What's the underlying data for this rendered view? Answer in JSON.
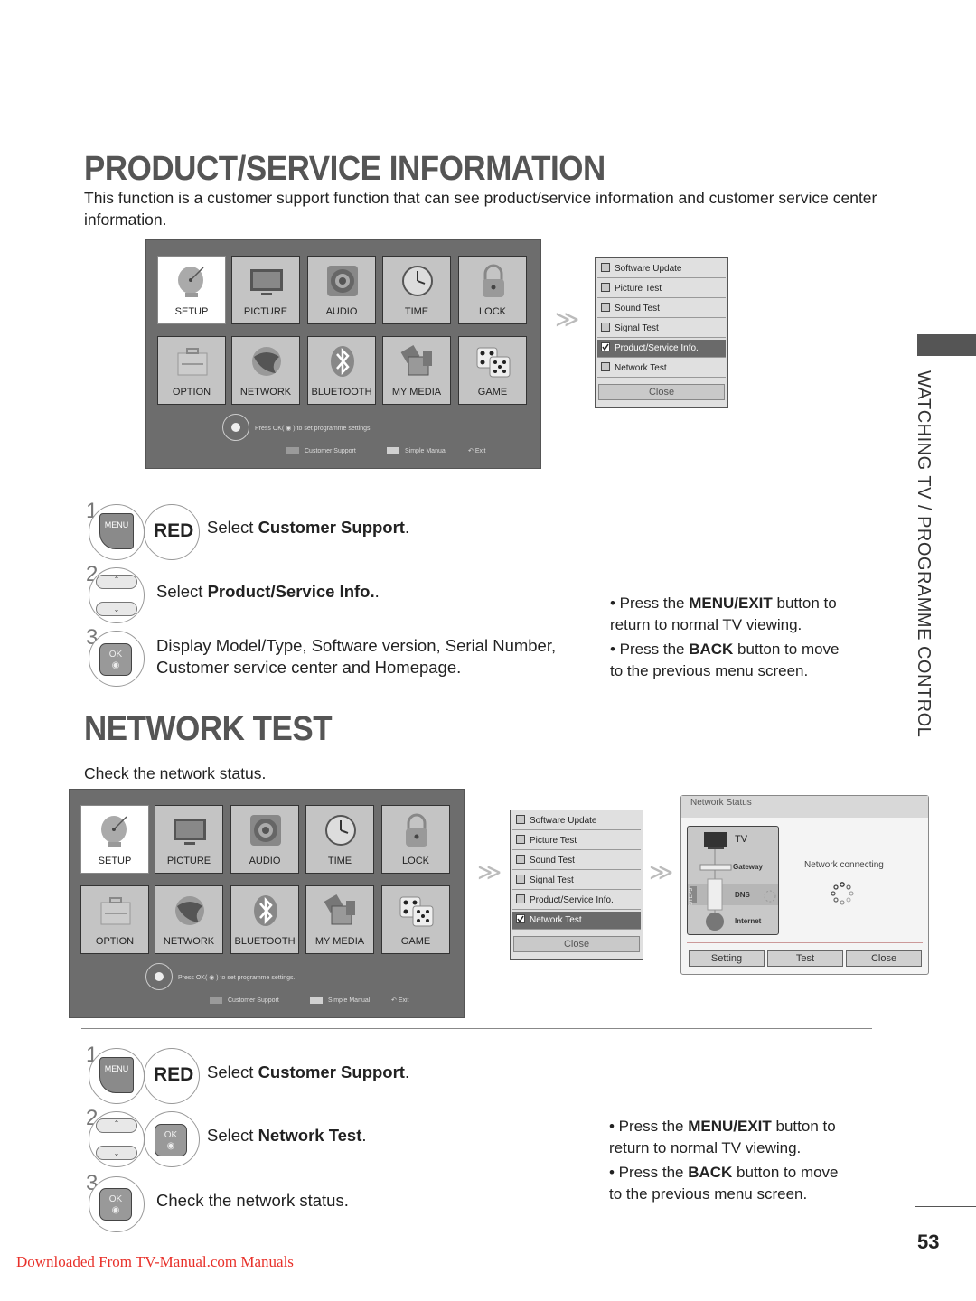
{
  "section1": {
    "title": "PRODUCT/SERVICE INFORMATION",
    "intro": "This function is a customer support function that can see product/service information and customer service center information.",
    "tv_menu": {
      "tiles": [
        {
          "label": "SETUP",
          "icon": "satellite-dish-icon",
          "selected": true
        },
        {
          "label": "PICTURE",
          "icon": "tv-monitor-icon",
          "selected": false
        },
        {
          "label": "AUDIO",
          "icon": "speaker-icon",
          "selected": false
        },
        {
          "label": "TIME",
          "icon": "clock-icon",
          "selected": false
        },
        {
          "label": "LOCK",
          "icon": "padlock-icon",
          "selected": false
        },
        {
          "label": "OPTION",
          "icon": "toolbox-icon",
          "selected": false
        },
        {
          "label": "NETWORK",
          "icon": "globe-icon",
          "selected": false
        },
        {
          "label": "BLUETOOTH",
          "icon": "bluetooth-icon",
          "selected": false
        },
        {
          "label": "MY MEDIA",
          "icon": "media-icon",
          "selected": false
        },
        {
          "label": "GAME",
          "icon": "dice-icon",
          "selected": false
        }
      ],
      "press_ok": "Press OK( ◉ ) to set programme settings.",
      "legend": [
        {
          "label": "Customer Support",
          "color": "#9a9a9a"
        },
        {
          "label": "Simple Manual",
          "color": "#d0d0d0"
        },
        {
          "label": "Exit",
          "icon": "exit-icon"
        }
      ]
    },
    "submenu": {
      "items": [
        {
          "label": "Software Update",
          "checked": false,
          "selected": false
        },
        {
          "label": "Picture Test",
          "checked": false,
          "selected": false
        },
        {
          "label": "Sound Test",
          "checked": false,
          "selected": false
        },
        {
          "label": "Signal Test",
          "checked": false,
          "selected": false
        },
        {
          "label": "Product/Service Info.",
          "checked": true,
          "selected": true
        },
        {
          "label": "Network Test",
          "checked": false,
          "selected": false
        }
      ],
      "close_label": "Close"
    },
    "steps": [
      {
        "num": "1",
        "button": "MENU",
        "button2": "RED",
        "text_pre": "Select ",
        "text_bold": "Customer Support",
        "text_post": "."
      },
      {
        "num": "2",
        "text_pre": "Select ",
        "text_bold": "Product/Service Info.",
        "text_post": "."
      },
      {
        "num": "3",
        "button": "OK",
        "line1": "Display Model/Type, Software version, Serial Number,",
        "line2": "Customer service center and Homepage."
      }
    ],
    "notes": [
      {
        "pre": "• Press the ",
        "bold": "MENU/EXIT",
        "post": " button to",
        "line2": "return to normal TV viewing."
      },
      {
        "pre": "• Press the ",
        "bold": "BACK",
        "post": " button to move",
        "line2": "to the previous menu screen."
      }
    ]
  },
  "section2": {
    "title": "NETWORK TEST",
    "intro": "Check the network status.",
    "submenu": {
      "items": [
        {
          "label": "Software Update",
          "checked": false,
          "selected": false
        },
        {
          "label": "Picture Test",
          "checked": false,
          "selected": false
        },
        {
          "label": "Sound Test",
          "checked": false,
          "selected": false
        },
        {
          "label": "Signal Test",
          "checked": false,
          "selected": false
        },
        {
          "label": "Product/Service Info.",
          "checked": false,
          "selected": false
        },
        {
          "label": "Network Test",
          "checked": true,
          "selected": true
        }
      ],
      "close_label": "Close"
    },
    "network_status": {
      "title": "Network Status",
      "nodes": [
        "TV",
        "Gateway",
        "DNS",
        "Internet"
      ],
      "step_tag": "STEP3",
      "status_text": "Network connecting",
      "buttons": [
        "Setting",
        "Test",
        "Close"
      ]
    },
    "steps": [
      {
        "num": "1",
        "button": "MENU",
        "button2": "RED",
        "text_pre": "Select ",
        "text_bold": "Customer Support",
        "text_post": "."
      },
      {
        "num": "2",
        "button": "OK",
        "text_pre": "Select ",
        "text_bold": "Network Test",
        "text_post": "."
      },
      {
        "num": "3",
        "button": "OK",
        "text": "Check the network status."
      }
    ],
    "notes": [
      {
        "pre": "• Press the ",
        "bold": "MENU/EXIT",
        "post": " button to",
        "line2": "return to normal TV viewing."
      },
      {
        "pre": "• Press the ",
        "bold": "BACK",
        "post": " button to move",
        "line2": "to the previous menu screen."
      }
    ]
  },
  "sidebar": {
    "label": "WATCHING TV / PROGRAMME CONTROL"
  },
  "page_number": "53",
  "footer_link": "Downloaded From TV-Manual.com Manuals"
}
